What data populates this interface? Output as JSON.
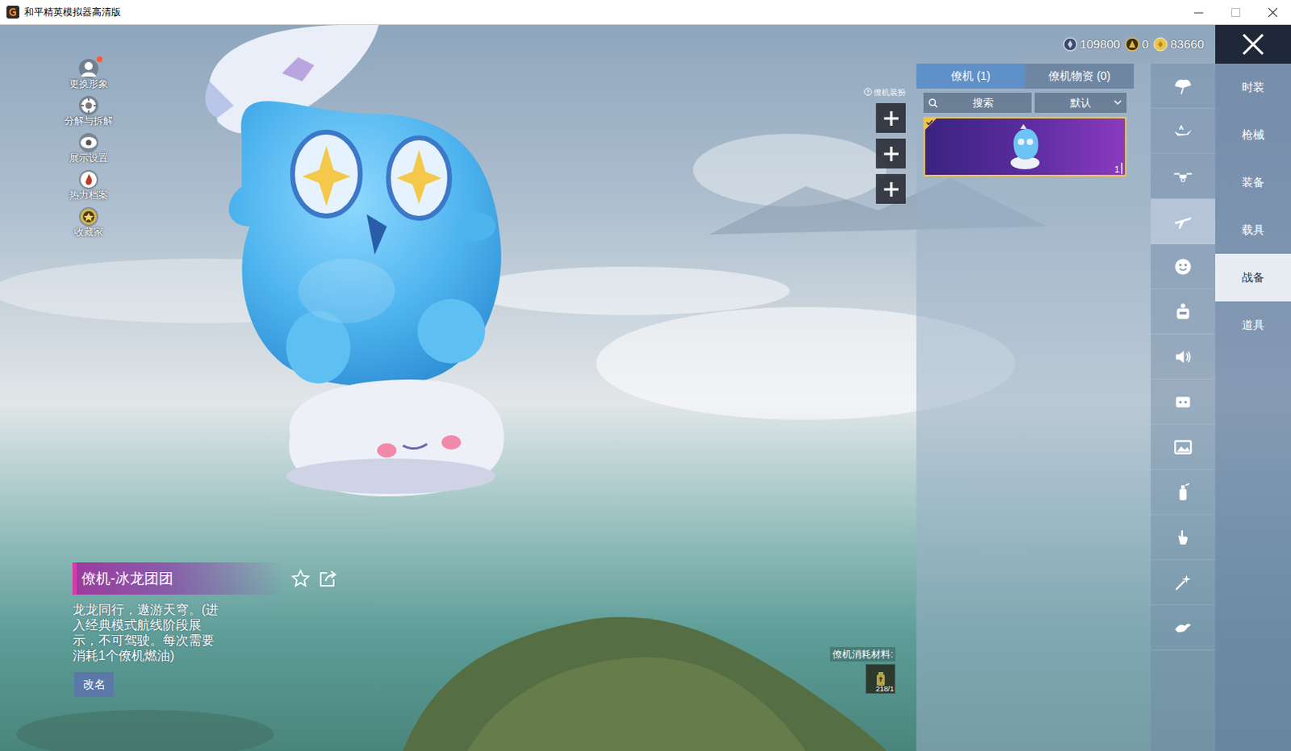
{
  "window": {
    "title": "和平精英模拟器高清版"
  },
  "left_menu": [
    {
      "label": "更换形象",
      "badge": true
    },
    {
      "label": "分解与拆解",
      "badge": false
    },
    {
      "label": "展示设置",
      "badge": false
    },
    {
      "label": "热力档案",
      "badge": false
    },
    {
      "label": "收藏家",
      "badge": false
    }
  ],
  "currencies": [
    {
      "amount": "109800"
    },
    {
      "amount": "0"
    },
    {
      "amount": "83660"
    }
  ],
  "outfit": {
    "label": "僚机装扮",
    "slots": [
      {
        "filled": false
      },
      {
        "filled": false
      },
      {
        "filled": false
      }
    ]
  },
  "panel": {
    "tabs": [
      {
        "label": "僚机 (1)",
        "selected": true
      },
      {
        "label": "僚机物资 (0)",
        "selected": false
      }
    ],
    "search": {
      "placeholder": "搜索"
    },
    "sort": "默认",
    "items": [
      {
        "count": "1",
        "selected": true,
        "equipped": true
      }
    ]
  },
  "icon_tabs": [
    {
      "selected": false
    },
    {
      "selected": false
    },
    {
      "selected": false
    },
    {
      "selected": true
    },
    {
      "selected": false
    },
    {
      "selected": false
    },
    {
      "selected": false
    },
    {
      "selected": false
    },
    {
      "selected": false
    },
    {
      "selected": false
    },
    {
      "selected": false
    },
    {
      "selected": false
    },
    {
      "selected": false
    }
  ],
  "categories": [
    {
      "label": "时装",
      "selected": false
    },
    {
      "label": "枪械",
      "selected": false
    },
    {
      "label": "装备",
      "selected": false
    },
    {
      "label": "载具",
      "selected": false
    },
    {
      "label": "战备",
      "selected": true
    },
    {
      "label": "道具",
      "selected": false
    }
  ],
  "detail": {
    "title": "僚机-冰龙团团",
    "favorite": false,
    "description": "龙龙同行，遨游天穹。(进入经典模式航线阶段展示，不可驾驶。每次需要消耗1个僚机燃油)",
    "rename": "改名"
  },
  "material": {
    "label": "僚机消耗材料:",
    "count": "218/1"
  }
}
